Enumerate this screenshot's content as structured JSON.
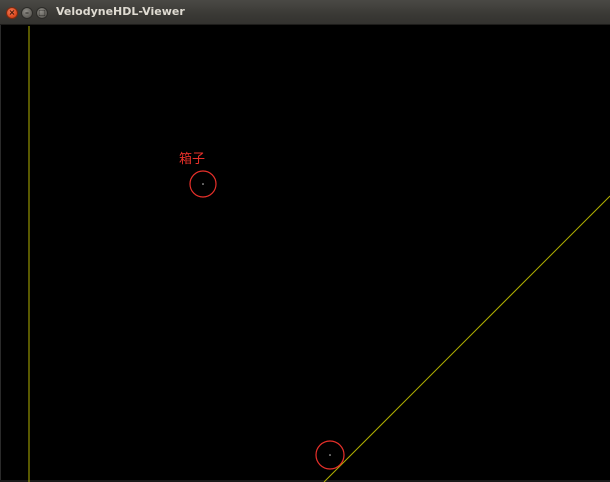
{
  "window": {
    "title": "VelodyneHDL-Viewer",
    "controls": {
      "close_icon": "close-icon",
      "minimize_icon": "minimize-icon",
      "maximize_icon": "maximize-icon"
    }
  },
  "viewport": {
    "background": "#000000",
    "axis_color": "#b0b000",
    "annotation_color": "#e8302a",
    "annotation_label": "箱子"
  }
}
